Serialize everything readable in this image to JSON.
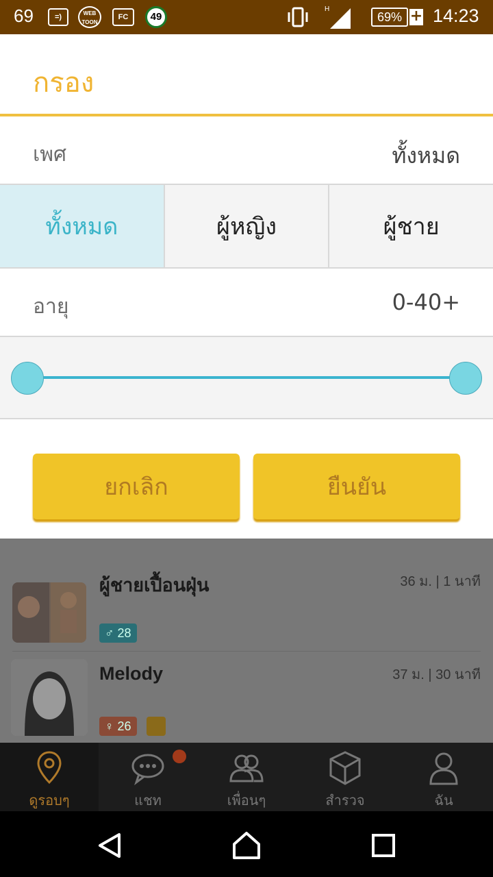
{
  "status_bar": {
    "notification_count": "69",
    "webtoon_label": "WEB TOON",
    "fc_label": "FC",
    "badge_count": "49",
    "signal_label": "H",
    "battery": "69%",
    "time": "14:23"
  },
  "dialog": {
    "title": "กรอง",
    "gender_label": "เพศ",
    "gender_value": "ทั้งหมด",
    "gender_options": [
      "ทั้งหมด",
      "ผู้หญิง",
      "ผู้ชาย"
    ],
    "gender_selected_index": 0,
    "age_label": "อายุ",
    "age_value": "0-40+",
    "age_range_min_fraction": 0.0,
    "age_range_max_fraction": 1.0,
    "cancel_label": "ยกเลิก",
    "confirm_label": "ยืนยัน"
  },
  "list": [
    {
      "name": "ผู้ชายเปื้อนฝุ่น",
      "meta": "36 ม. | 1 นาที",
      "tag": "♂ 28",
      "tag_color": "#2a7f86"
    },
    {
      "name": "Melody",
      "meta": "37 ม. | 30 นาที",
      "tag": "♀ 26",
      "tag_color": "#a8523a"
    }
  ],
  "bottom_nav": {
    "items": [
      {
        "label": "ดูรอบๆ",
        "icon": "location-pin-icon"
      },
      {
        "label": "แชท",
        "icon": "chat-bubble-icon"
      },
      {
        "label": "เพื่อนๆ",
        "icon": "friends-icon"
      },
      {
        "label": "สำรวจ",
        "icon": "cube-icon"
      },
      {
        "label": "ฉัน",
        "icon": "person-icon"
      }
    ]
  },
  "colors": {
    "accent": "#f0c428",
    "title": "#f0b432",
    "selected": "#3bb4c8",
    "status_bar": "#6b3d00"
  }
}
